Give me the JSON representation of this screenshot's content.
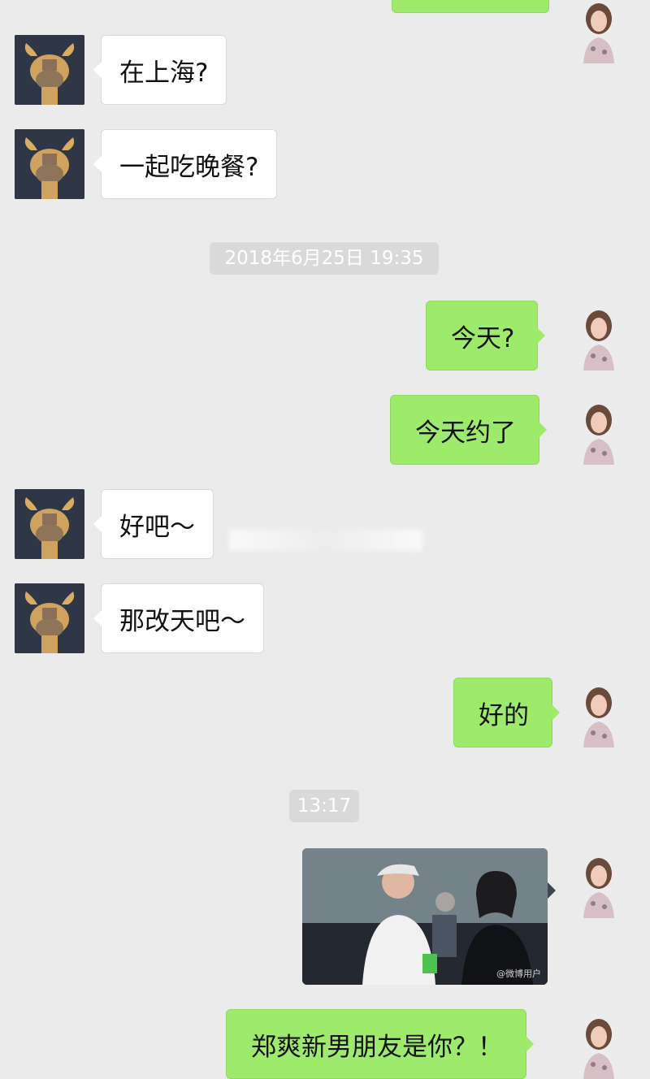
{
  "messages": [
    {
      "sender": "contact",
      "text": "在上海?"
    },
    {
      "sender": "contact",
      "text": "一起吃晚餐?"
    },
    {
      "sender": "self",
      "text": "今天?"
    },
    {
      "sender": "self",
      "text": "今天约了"
    },
    {
      "sender": "contact",
      "text": "好吧～"
    },
    {
      "sender": "contact",
      "text": "那改天吧～"
    },
    {
      "sender": "self",
      "text": "好的"
    },
    {
      "sender": "self",
      "text": "郑爽新男朋友是你？！"
    }
  ],
  "timestamps": [
    "2018年6月25日 19:35",
    "13:17"
  ],
  "image_message": {
    "watermark": "@微博用户"
  },
  "colors": {
    "background": "#ebebeb",
    "incoming_bubble": "#ffffff",
    "outgoing_bubble": "#9eea6a",
    "timestamp_bg": "#d9d9d9"
  },
  "icons": {
    "contact_avatar": "cow-cartoon-avatar",
    "self_avatar": "woman-portrait-avatar"
  }
}
